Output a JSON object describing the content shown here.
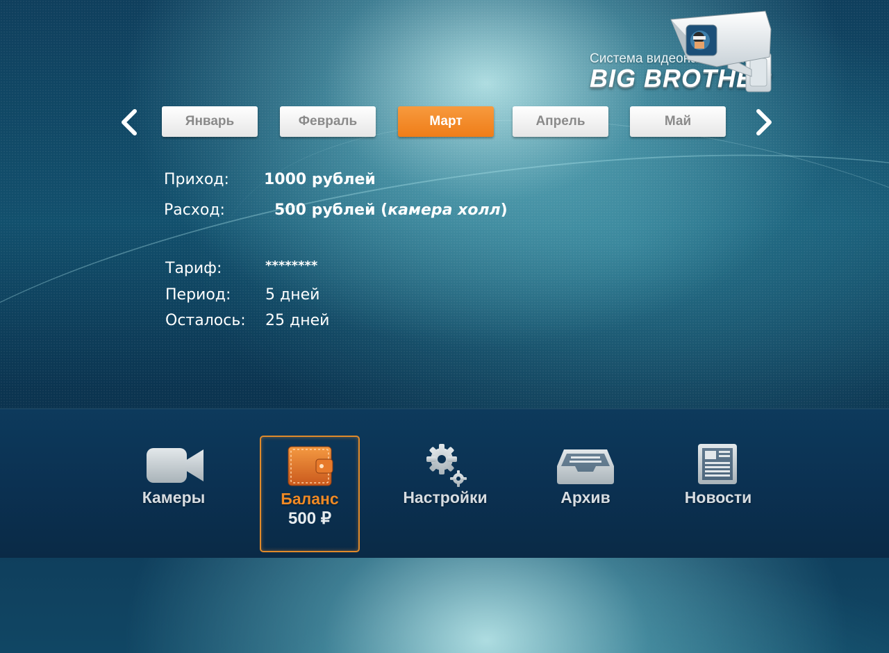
{
  "logo": {
    "subtitle": "Система видеонаблюдения",
    "title": "BIG BROTHER"
  },
  "months": {
    "items": [
      "Январь",
      "Февраль",
      "Март",
      "Апрель",
      "Май"
    ],
    "active": "Март"
  },
  "finance": {
    "income_label": "Приход:",
    "income_value": "1000 рублей",
    "expense_label": "Расход:",
    "expense_amount": "500 рублей (",
    "expense_note": "камера холл",
    "expense_close": ")"
  },
  "tariff": {
    "tariff_label": "Тариф:",
    "tariff_value": "********",
    "period_label": "Период:",
    "period_value": "5 дней",
    "remaining_label": "Осталось:",
    "remaining_value": "25 дней"
  },
  "bottom_nav": {
    "cameras": "Камеры",
    "balance": "Баланс",
    "balance_amount": "500 ₽",
    "settings": "Настройки",
    "archive": "Архив",
    "news": "Новости"
  },
  "colors": {
    "accent": "#ef7d18",
    "background": "#0f3f5d"
  }
}
